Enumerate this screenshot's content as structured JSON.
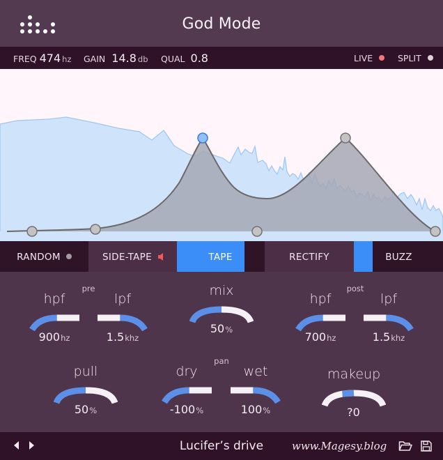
{
  "header": {
    "title": "God Mode",
    "logo_icon": "dot-bars-logo-icon"
  },
  "infobar": {
    "freq": {
      "label": "FREQ",
      "value": "474",
      "unit": "hz"
    },
    "gain": {
      "label": "GAIN",
      "value": "14.8",
      "unit": "db"
    },
    "qual": {
      "label": "QUAL",
      "value": "0.8"
    },
    "live": {
      "label": "LIVE",
      "dot_color": "#f4787a"
    },
    "split": {
      "label": "SPLIT",
      "dot_color": "#d9d2d7"
    }
  },
  "graph": {
    "spectrum_color": "#cfe3fb",
    "spectrum_line_color": "#9cc7f5",
    "eq_fill_color": "#a3a6b2",
    "eq_line_color": "#6b6868",
    "selected_handle_color": "#8ec0f6",
    "handles": [
      {
        "id": "band-1",
        "selected": false
      },
      {
        "id": "band-2",
        "selected": false
      },
      {
        "id": "band-3",
        "selected": true
      },
      {
        "id": "band-4",
        "selected": false
      },
      {
        "id": "band-5",
        "selected": false
      },
      {
        "id": "band-6",
        "selected": false
      }
    ]
  },
  "modes": {
    "random": {
      "label": "RANDOM",
      "icon": "dot-icon"
    },
    "side_tape": {
      "label": "SIDE-TAPE",
      "icon": "speaker-icon",
      "icon_color": "#f05a5a"
    },
    "tape": {
      "label": "TAPE",
      "active": true
    },
    "rectify": {
      "label": "RECTIFY",
      "active": false
    },
    "buzz": {
      "label": "BUZZ",
      "active": true
    }
  },
  "controls": {
    "pre": {
      "group_label": "pre",
      "hpf": {
        "label": "hpf",
        "value": "900",
        "unit": "hz",
        "fill": 0.5
      },
      "lpf": {
        "label": "lpf",
        "value": "1.5",
        "unit": "khz",
        "fill": 0.5
      }
    },
    "mix": {
      "label": "mix",
      "value": "50",
      "unit": "%",
      "fill": 0.5
    },
    "post": {
      "group_label": "post",
      "hpf": {
        "label": "hpf",
        "value": "700",
        "unit": "hz",
        "fill": 0.5
      },
      "lpf": {
        "label": "lpf",
        "value": "1.5",
        "unit": "khz",
        "fill": 0.5
      }
    },
    "pull": {
      "label": "pull",
      "value": "50",
      "unit": "%",
      "fill": 0.5
    },
    "pan": {
      "group_label": "pan",
      "dry": {
        "label": "dry",
        "value": "-100",
        "unit": "%",
        "fill": 0.5
      },
      "wet": {
        "label": "wet",
        "value": "100",
        "unit": "%",
        "fill": 0.5
      }
    },
    "makeup": {
      "label": "makeup",
      "value": "?0",
      "unit": "",
      "fill_from": 0.3,
      "fill_to": 0.5
    },
    "arc_active_color": "#5b8fe8",
    "arc_track_color": "#f5f1f4"
  },
  "footer": {
    "preset_name": "Lucifer’s drive",
    "watermark": "www.Magesy.blog",
    "prev_icon": "triangle-left-icon",
    "next_icon": "triangle-right-icon",
    "open_icon": "folder-icon",
    "save_icon": "floppy-disk-icon"
  }
}
